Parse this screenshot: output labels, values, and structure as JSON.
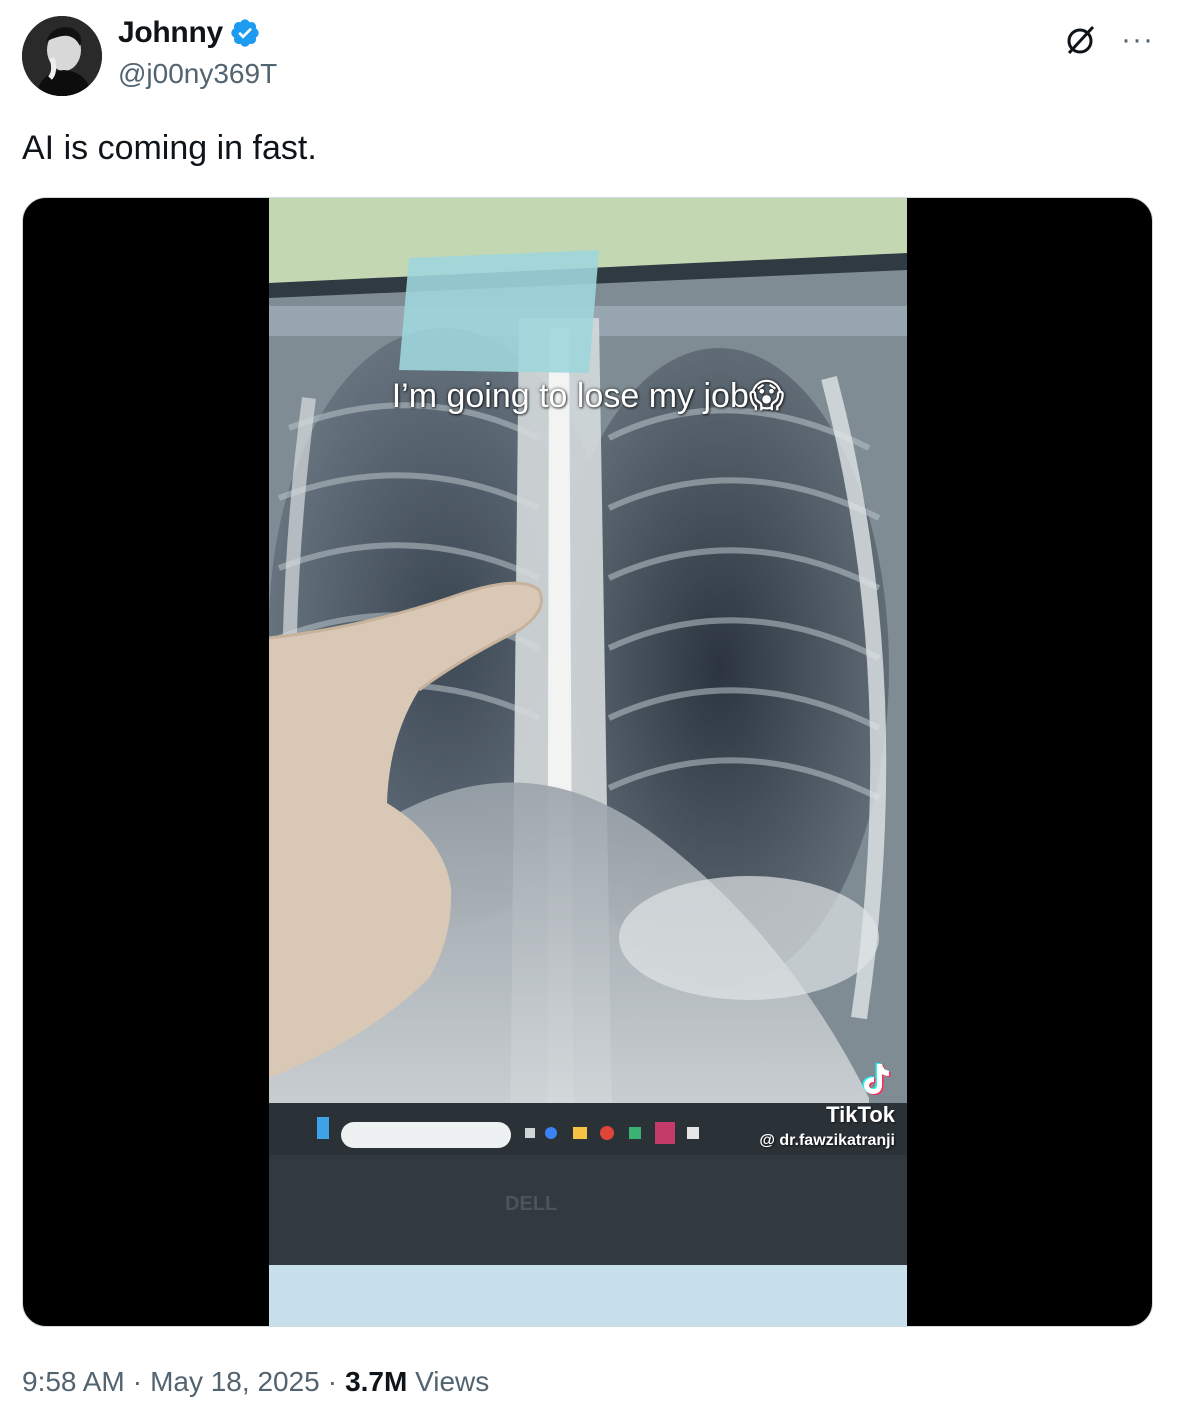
{
  "author": {
    "display_name": "Johnny",
    "handle": "@j00ny369T",
    "verified_color": "#1d9bf0"
  },
  "actions": {
    "grok_icon": "grok-icon",
    "more_label": "···"
  },
  "tweet": {
    "text": "AI is coming in fast."
  },
  "media": {
    "caption": "I’m going to lose my job😱",
    "tiktok_label": "TikTok",
    "tiktok_user": "@ dr.fawzikatranji",
    "monitor_brand": "DELL"
  },
  "meta": {
    "time": "9:58 AM",
    "date": "May 18, 2025",
    "views_count": "3.7M",
    "views_label": "Views"
  }
}
